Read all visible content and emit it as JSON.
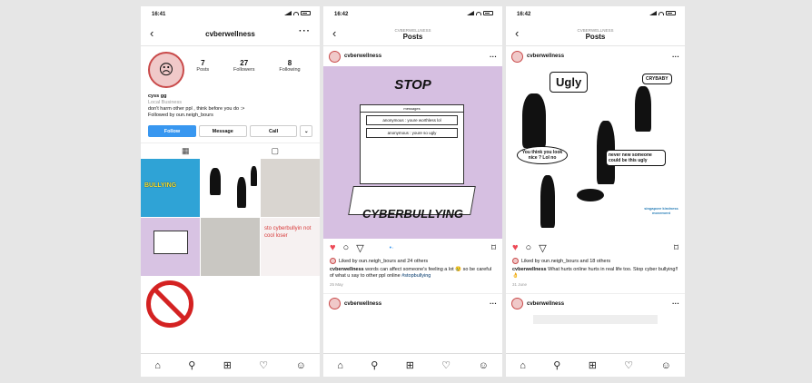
{
  "profile_screen": {
    "time": "16:41",
    "username": "cvberwellness",
    "stats": [
      {
        "value": "7",
        "label": "Posts"
      },
      {
        "value": "27",
        "label": "Followers"
      },
      {
        "value": "8",
        "label": "Following"
      }
    ],
    "bio_name": "cyss gg",
    "bio_category": "Local Business",
    "bio_text": "don't harm other ppl , think before you do :>",
    "followed_by": "Followed by oun.neigh_bours",
    "buttons": {
      "follow": "Follow",
      "message": "Message",
      "call": "Call",
      "dropdown": "⌄"
    },
    "grid_texts": {
      "bullying": "BULLYING",
      "cyber_stop": "sto cyberbullyin not cool loser",
      "no_sign": "CYBER BULLYING"
    }
  },
  "post_screen_1": {
    "time": "16:42",
    "header_sub": "CVBERWELLNESS",
    "header_title": "Posts",
    "username": "cvberwellness",
    "image": {
      "top_text": "STOP",
      "bottom_text": "CYBERBULLYING",
      "messages_header": "messages",
      "msg1": "anonymous : youre worthless lol",
      "msg2": "anonymous : youre so ugly"
    },
    "liked_by": "Liked by oun.neigh_bours and 24 others",
    "caption_user": "cvberwellness",
    "caption": "words can affect someone's feeling a lot 😢 so be careful of what u say to other ppl online",
    "hashtag": "#stopbullying",
    "date": "25 May",
    "next_username": "cvberwellness"
  },
  "post_screen_2": {
    "time": "16:42",
    "header_sub": "CVBERWELLNESS",
    "header_title": "Posts",
    "username": "cvberwellness",
    "image": {
      "bubble1": "Ugly",
      "bubble2": "CRYBABY",
      "bubble3": "You think you look nice ? Lol no",
      "bubble4": "never new someone could be this ugly",
      "logo": "singapore kindness movement"
    },
    "liked_by": "Liked by oun.neigh_bours and 18 others",
    "caption_user": "cvberwellness",
    "caption": "What hurts online hurts in real life too. Stop cyber bullying!!👌",
    "date": "31 June",
    "next_username": "cvberwellness"
  },
  "colors": {
    "accent": "#3897f0",
    "heart": "#ed4956",
    "purple": "#d6bfe1"
  }
}
